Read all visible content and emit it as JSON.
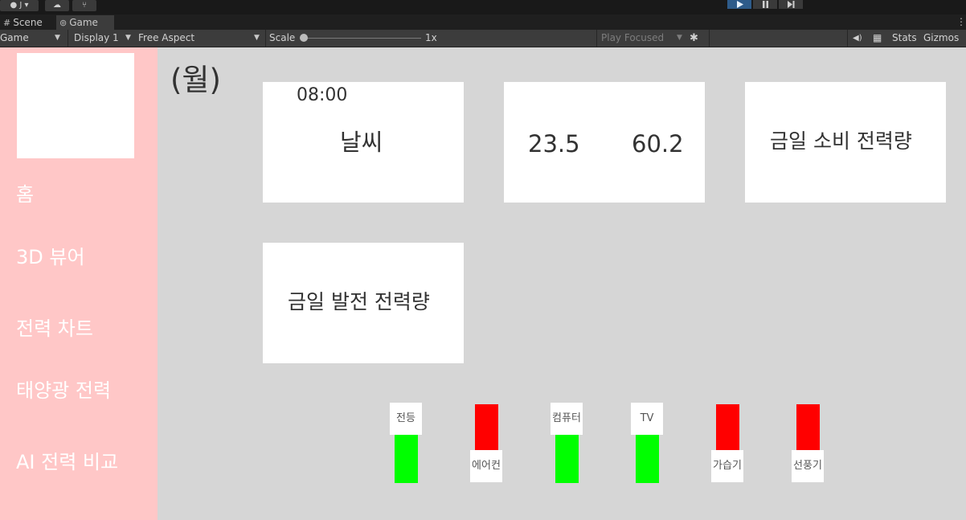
{
  "editor": {
    "topbar": {
      "account_label": "J",
      "account_caret": "▾"
    },
    "tabs": [
      {
        "label": "Scene",
        "icon": "grid-icon",
        "glyph": "#"
      },
      {
        "label": "Game",
        "icon": "gamepad-icon",
        "glyph": "⊚"
      }
    ],
    "toolbar": {
      "view_mode": "Game",
      "display": "Display 1",
      "aspect": "Free Aspect",
      "scale_label": "Scale",
      "scale_value": "1x",
      "scale_level": 0,
      "play_mode": "Play Focused",
      "stats_label": "Stats",
      "gizmos_label": "Gizmos"
    }
  },
  "app": {
    "sidebar": {
      "items": [
        {
          "label": "홈"
        },
        {
          "label": "3D 뷰어"
        },
        {
          "label": "전력 차트"
        },
        {
          "label": "태양광 전력"
        },
        {
          "label": "AI 전력 비교"
        }
      ]
    },
    "day_label": "(월)",
    "cards": {
      "weather": {
        "time": "08:00",
        "label": "날씨"
      },
      "climate": {
        "temperature": "23.5",
        "humidity": "60.2"
      },
      "consumption": {
        "label": "금일 소비 전력량"
      },
      "generation": {
        "label": "금일 발전 전력량"
      }
    },
    "devices": [
      {
        "name": "전등",
        "state": "on"
      },
      {
        "name": "에어컨",
        "state": "off"
      },
      {
        "name": "컴퓨터",
        "state": "on"
      },
      {
        "name": "TV",
        "state": "on"
      },
      {
        "name": "가습기",
        "state": "off"
      },
      {
        "name": "선풍기",
        "state": "off"
      }
    ],
    "colors": {
      "on": "#00ff00",
      "off": "#ff0000",
      "sidebar": "#ffc7c7",
      "background": "#d6d6d6"
    }
  }
}
